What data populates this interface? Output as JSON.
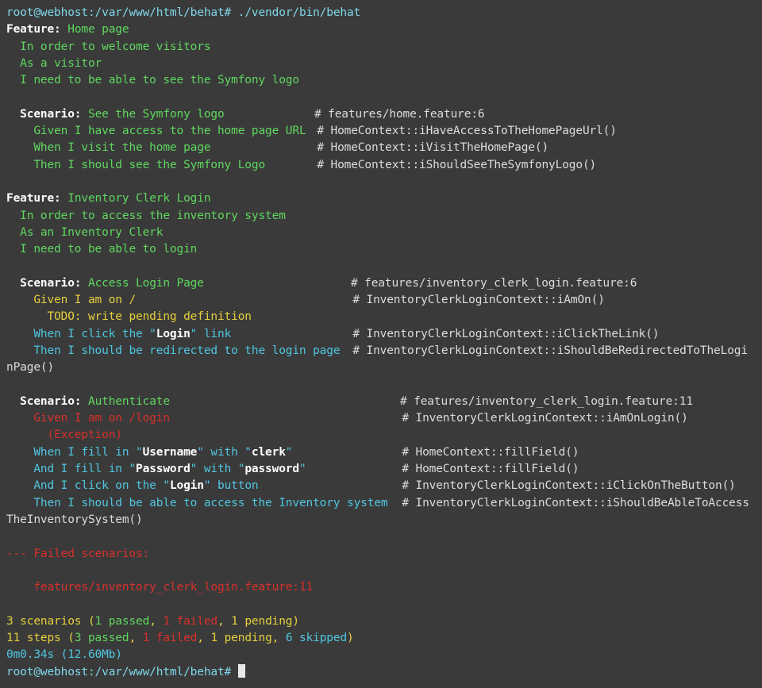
{
  "terminal": {
    "command_prompt": "root@webhost:/var/www/html/behat#",
    "command": "./vendor/bin/behat",
    "feature1": {
      "keyword": "Feature:",
      "title": "Home page",
      "desc1": "In order to welcome visitors",
      "desc2": "As a visitor",
      "desc3": "I need to be able to see the Symfony logo",
      "scenario": {
        "keyword": "Scenario:",
        "title": "See the Symfony logo",
        "comment": "# features/home.feature:6",
        "steps": [
          {
            "text": "Given I have access to the home page URL",
            "comment": "# HomeContext::iHaveAccessToTheHomePageUrl()"
          },
          {
            "text": "When I visit the home page",
            "comment": "# HomeContext::iVisitTheHomePage()"
          },
          {
            "text": "Then I should see the Symfony Logo",
            "comment": "# HomeContext::iShouldSeeTheSymfonyLogo()"
          }
        ]
      }
    },
    "feature2": {
      "keyword": "Feature:",
      "title": "Inventory Clerk Login",
      "desc1": "In order to access the inventory system",
      "desc2": "As an Inventory Clerk",
      "desc3": "I need to be able to login",
      "scenario1": {
        "keyword": "Scenario:",
        "title": "Access Login Page",
        "comment": "# features/inventory_clerk_login.feature:6",
        "step1": "Given I am on /",
        "step1_comment": "# InventoryClerkLoginContext::iAmOn()",
        "todo": "TODO: write pending definition",
        "step2_pre": "When I click the \"",
        "step2_arg": "Login",
        "step2_post": "\" link",
        "step2_comment": "# InventoryClerkLoginContext::iClickTheLink()",
        "step3": "Then I should be redirected to the login page",
        "step3_comment": "# InventoryClerkLoginContext::iShouldBeRedirectedToTheLogi",
        "step3_wrap": "nPage()"
      },
      "scenario2": {
        "keyword": "Scenario:",
        "title": "Authenticate",
        "comment": "# features/inventory_clerk_login.feature:11",
        "step1": "Given I am on /login",
        "step1_comment": "# InventoryClerkLoginContext::iAmOnLogin()",
        "exception": "(Exception)",
        "step2_a": "When I fill in \"",
        "step2_b": "Username",
        "step2_c": "\" with \"",
        "step2_d": "clerk",
        "step2_e": "\"",
        "step2_comment": "# HomeContext::fillField()",
        "step3_a": "And I fill in \"",
        "step3_b": "Password",
        "step3_c": "\" with \"",
        "step3_d": "password",
        "step3_e": "\"",
        "step3_comment": "# HomeContext::fillField()",
        "step4_a": "And I click on the \"",
        "step4_b": "Login",
        "step4_c": "\" button",
        "step4_comment": "# InventoryClerkLoginContext::iClickOnTheButton()",
        "step5": "Then I should be able to access the Inventory system",
        "step5_comment": "# InventoryClerkLoginContext::iShouldBeAbleToAccess",
        "step5_wrap": "TheInventorySystem()"
      }
    },
    "failed_header": "--- Failed scenarios:",
    "failed_item": "features/inventory_clerk_login.feature:11",
    "summary": {
      "scenarios_a": "3 scenarios (",
      "scenarios_passed": "1 passed",
      "sep1": ", ",
      "scenarios_failed": "1 failed",
      "sep2": ", ",
      "scenarios_pending": "1 pending",
      "scenarios_end": ")",
      "steps_a": "11 steps (",
      "steps_passed": "3 passed",
      "steps_sep1": ", ",
      "steps_failed": "1 failed",
      "steps_sep2": ", ",
      "steps_pending": "1 pending",
      "steps_sep3": ", ",
      "steps_skipped": "6 skipped",
      "steps_end": ")",
      "time": "0m0.34s (12.60Mb)"
    },
    "final_prompt": "root@webhost:/var/www/html/behat#"
  },
  "colors": {
    "background": "#3a3a3a",
    "passed": "#5fd75f",
    "pending": "#e5cf3d",
    "failed": "#d9302b",
    "skipped": "#4fc6e0",
    "prompt": "#7fd7e8"
  }
}
